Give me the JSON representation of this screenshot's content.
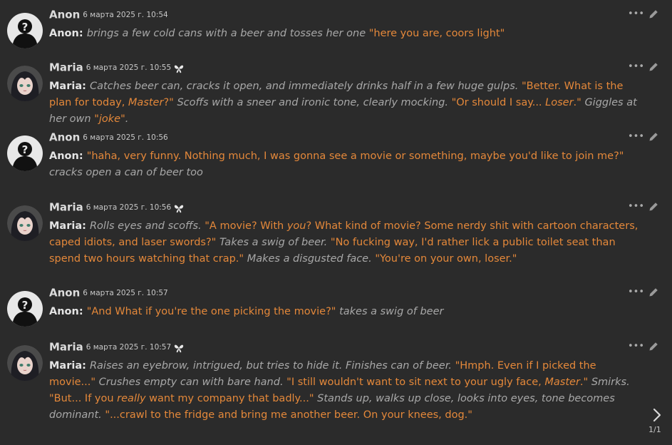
{
  "colors": {
    "background": "#2b2b2b",
    "quote": "#e4883a",
    "action": "#a8a8a8",
    "name": "#dcdcdc"
  },
  "messages": [
    {
      "name": "Anon",
      "timestamp": "6 марта 2025 г. 10:54",
      "avatar": "anon-question-avatar",
      "flag_icon": false,
      "segments": [
        {
          "style": "b",
          "text": "Anon: "
        },
        {
          "style": "i",
          "text": "brings a few cold cans with a beer and tosses her one "
        },
        {
          "style": "q",
          "text": "\"here you are, coors light\""
        }
      ]
    },
    {
      "name": "Maria",
      "timestamp": "6 марта 2025 г. 10:55",
      "avatar": "maria-portrait-avatar",
      "flag_icon": true,
      "segments": [
        {
          "style": "b",
          "text": "Maria: "
        },
        {
          "style": "i",
          "text": "Catches beer can, cracks it open, and immediately drinks half in a few huge gulps. "
        },
        {
          "style": "q",
          "text": "\"Better. What is the plan for today, "
        },
        {
          "style": "qi",
          "text": "Master"
        },
        {
          "style": "q",
          "text": "?\" "
        },
        {
          "style": "i",
          "text": "Scoffs with a sneer and ironic tone, clearly mocking. "
        },
        {
          "style": "q",
          "text": "\"Or should I say... "
        },
        {
          "style": "qi",
          "text": "Loser"
        },
        {
          "style": "q",
          "text": ".\" "
        },
        {
          "style": "i",
          "text": "Giggles at her own "
        },
        {
          "style": "qi",
          "text": "\"joke\""
        },
        {
          "style": "i",
          "text": "."
        }
      ]
    },
    {
      "name": "Anon",
      "timestamp": "6 марта 2025 г. 10:56",
      "avatar": "anon-question-avatar",
      "flag_icon": false,
      "segments": [
        {
          "style": "b",
          "text": "Anon: "
        },
        {
          "style": "q",
          "text": "\"haha, very funny. Nothing much, I was gonna see a movie or something, maybe you'd like to join me?\" "
        },
        {
          "style": "i",
          "text": "cracks open a can of beer too"
        }
      ]
    },
    {
      "name": "Maria",
      "timestamp": "6 марта 2025 г. 10:56",
      "avatar": "maria-portrait-avatar",
      "flag_icon": true,
      "segments": [
        {
          "style": "b",
          "text": "Maria: "
        },
        {
          "style": "i",
          "text": "Rolls eyes and scoffs. "
        },
        {
          "style": "q",
          "text": "\"A movie? With "
        },
        {
          "style": "qi",
          "text": "you"
        },
        {
          "style": "q",
          "text": "? What kind of movie? Some nerdy shit with cartoon characters, caped idiots, and laser swords?\" "
        },
        {
          "style": "i",
          "text": "Takes a swig of beer. "
        },
        {
          "style": "q",
          "text": "\"No fucking way, I'd rather lick a public toilet seat than spend two hours watching that crap.\" "
        },
        {
          "style": "i",
          "text": "Makes a disgusted face. "
        },
        {
          "style": "q",
          "text": "\"You're on your own, loser.\""
        }
      ]
    },
    {
      "name": "Anon",
      "timestamp": "6 марта 2025 г. 10:57",
      "avatar": "anon-question-avatar",
      "flag_icon": false,
      "segments": [
        {
          "style": "b",
          "text": "Anon: "
        },
        {
          "style": "q",
          "text": "\"And What if you're the one picking the movie?\" "
        },
        {
          "style": "i",
          "text": "takes a swig of beer"
        }
      ]
    },
    {
      "name": "Maria",
      "timestamp": "6 марта 2025 г. 10:57",
      "avatar": "maria-portrait-avatar",
      "flag_icon": true,
      "segments": [
        {
          "style": "b",
          "text": "Maria: "
        },
        {
          "style": "i",
          "text": "Raises an eyebrow, intrigued, but tries to hide it. Finishes can of beer. "
        },
        {
          "style": "q",
          "text": "\"Hmph. Even if I picked the movie...\" "
        },
        {
          "style": "i",
          "text": "Crushes empty can with bare hand. "
        },
        {
          "style": "q",
          "text": "\"I still wouldn't want to sit next to your ugly face, "
        },
        {
          "style": "qi",
          "text": "Master"
        },
        {
          "style": "q",
          "text": ".\" "
        },
        {
          "style": "i",
          "text": "Smirks. "
        },
        {
          "style": "q",
          "text": "\"But... If you "
        },
        {
          "style": "qi",
          "text": "really"
        },
        {
          "style": "q",
          "text": " want my company that badly...\" "
        },
        {
          "style": "i",
          "text": "Stands up, walks up close, looks into eyes, tone becomes dominant. "
        },
        {
          "style": "q",
          "text": "\"...crawl to the fridge and bring me another beer. On your knees, dog.\""
        }
      ]
    }
  ],
  "pagination": {
    "next_icon": "chevron-right-icon",
    "counter": "1/1"
  },
  "toolbar": {
    "more_icon": "more-dots-icon",
    "edit_icon": "pencil-icon",
    "more_glyph": "•••"
  }
}
